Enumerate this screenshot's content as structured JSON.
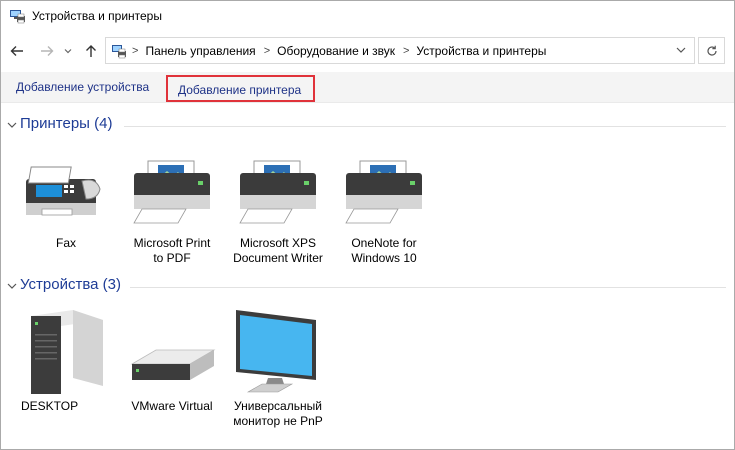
{
  "window": {
    "title": "Устройства и принтеры"
  },
  "address": {
    "crumbs": [
      "Панель управления",
      "Оборудование и звук",
      "Устройства и принтеры"
    ]
  },
  "commands": {
    "add_device": "Добавление устройства",
    "add_printer": "Добавление принтера"
  },
  "groups": {
    "printers": {
      "title": "Принтеры (4)",
      "items": [
        {
          "line1": "Fax",
          "line2": "",
          "icon": "fax-icon"
        },
        {
          "line1": "Microsoft Print",
          "line2": "to PDF",
          "icon": "printer-icon"
        },
        {
          "line1": "Microsoft XPS",
          "line2": "Document Writer",
          "icon": "printer-icon"
        },
        {
          "line1": "OneNote for",
          "line2": "Windows 10",
          "icon": "printer-icon"
        }
      ]
    },
    "devices": {
      "title": "Устройства (3)",
      "items": [
        {
          "line1": "DESKTOP",
          "line2": "",
          "icon": "computer-tower-icon"
        },
        {
          "line1": "VMware Virtual",
          "line2": "",
          "icon": "external-drive-icon"
        },
        {
          "line1": "Универсальный",
          "line2": "монитор не PnP",
          "icon": "monitor-icon"
        }
      ]
    }
  },
  "colors": {
    "accent": "#1e3c96",
    "highlight_border": "#e0323a"
  }
}
